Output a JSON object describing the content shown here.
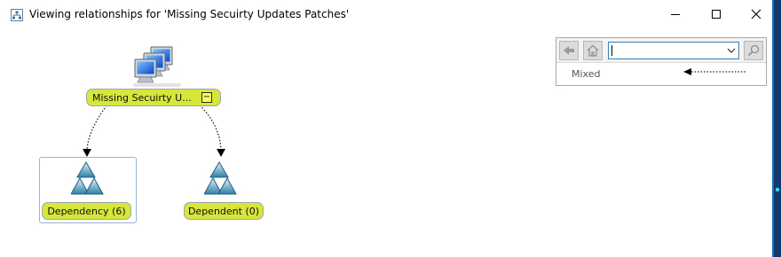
{
  "window": {
    "title": "Viewing relationships for 'Missing Secuirty Updates Patches'",
    "icon": "hierarchy-icon",
    "controls": [
      "minimize-icon",
      "maximize-icon",
      "close-icon"
    ]
  },
  "graph": {
    "root": {
      "label": "Missing Secuirty U...",
      "collapse_symbol": "−",
      "icon": "computers-icon",
      "highlight_color": "#d6e63b"
    },
    "children": [
      {
        "label": "Dependency (6)",
        "icon": "triangle-cluster-icon"
      },
      {
        "label": "Dependent (0)",
        "icon": "triangle-cluster-icon"
      }
    ]
  },
  "navigation": {
    "search_value": "",
    "filter_label": "Mixed",
    "icons": [
      "back-arrow-icon",
      "home-icon",
      "dropdown-arrow-icon",
      "search-icon"
    ]
  }
}
